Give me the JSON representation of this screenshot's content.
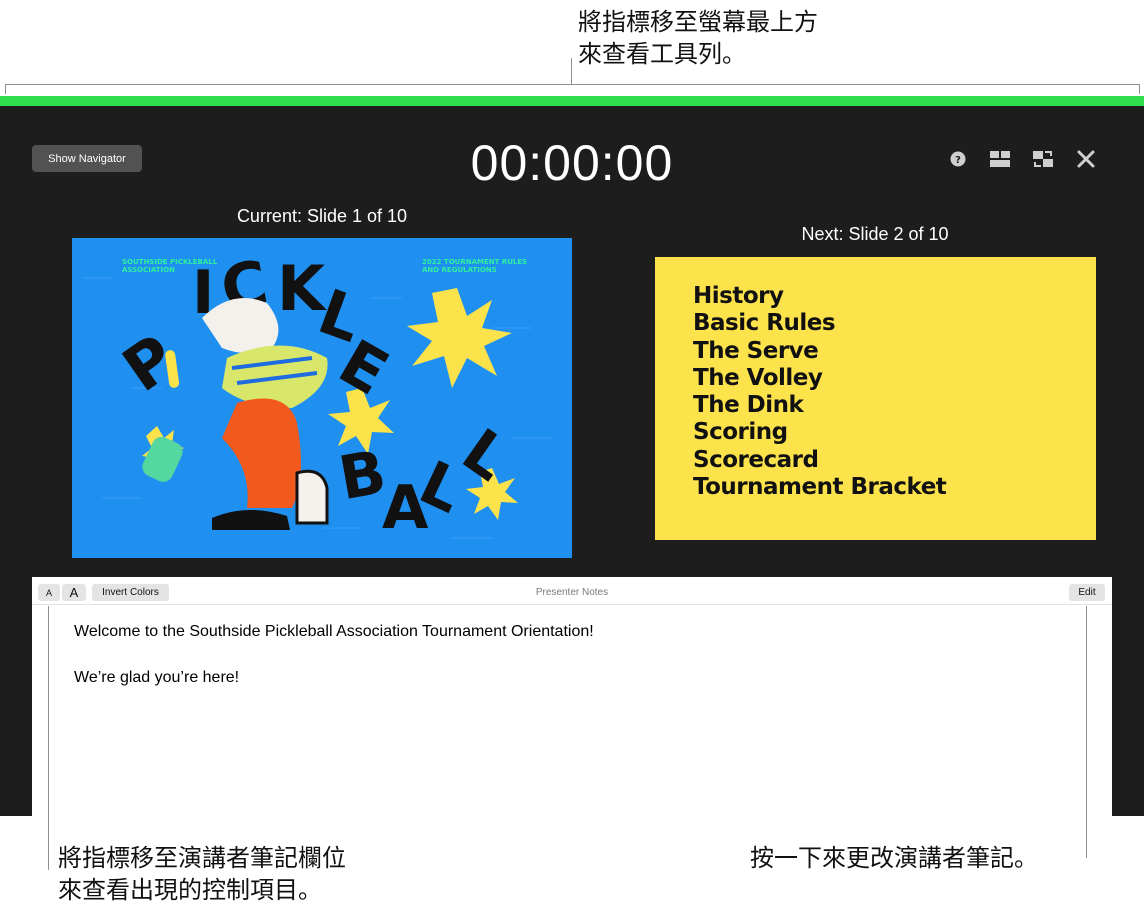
{
  "callouts": {
    "top": "將指標移至螢幕最上方\n來查看工具列。",
    "bottom_left": "將指標移至演講者筆記欄位\n來查看出現的控制項目。",
    "bottom_right": "按一下來更改演講者筆記。"
  },
  "presenter": {
    "show_navigator": "Show Navigator",
    "timer": "00:00:00",
    "current_label": "Current: Slide 1 of 10",
    "next_label": "Next: Slide 2 of 10",
    "toolbar_icons": [
      "help-icon",
      "layout-icon",
      "switch-displays-icon",
      "close-icon"
    ],
    "current_slide": {
      "header_left": "SOUTHSIDE PICKLEBALL ASSOCIATION",
      "header_right": "2022 TOURNAMENT RULES AND REGULATIONS",
      "title_word_1": "PICKLE",
      "title_word_2": "BALL"
    },
    "next_slide": {
      "items": [
        "History",
        "Basic Rules",
        "The Serve",
        "The Volley",
        "The Dink",
        "Scoring",
        "Scorecard",
        "Tournament Bracket"
      ]
    }
  },
  "notes": {
    "font_smaller": "A",
    "font_larger": "A",
    "invert_colors": "Invert Colors",
    "title": "Presenter Notes",
    "edit": "Edit",
    "paragraphs": [
      "Welcome to the Southside Pickleball Association Tournament Orientation!",
      "We’re glad you’re here!"
    ]
  },
  "colors": {
    "window_bg": "#1d1d1d",
    "accent_green": "#2fdd4d",
    "current_slide_bg": "#1f8ff0",
    "next_slide_bg": "#fde34b"
  }
}
